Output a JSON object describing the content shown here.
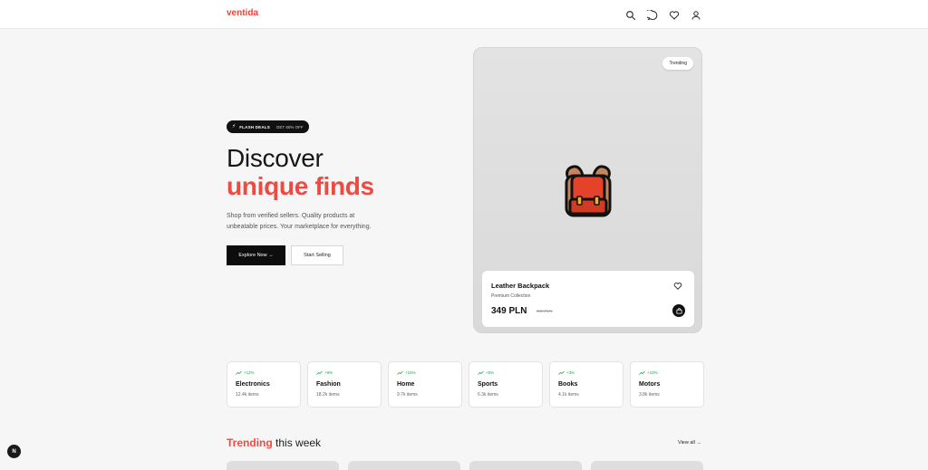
{
  "header": {
    "logo": "ventida",
    "icons": [
      "search-icon",
      "chat-icon",
      "heart-icon",
      "user-icon"
    ]
  },
  "hero": {
    "badge_label": "FLASH DEALS",
    "badge_offer": "GET 60% OFF",
    "headline_line1": "Discover",
    "headline_line2": "unique finds",
    "subtext": "Shop from verified sellers. Quality products at unbeatable prices. Your marketplace for everything.",
    "primary_cta": "Explore Now →",
    "secondary_cta": "Start Selling"
  },
  "featured": {
    "pill": "Trending",
    "product_name": "Leather Backpack",
    "collection": "Premium Collection",
    "price": "349 PLN",
    "old_price": "699 PLN",
    "image_icon": "backpack-icon"
  },
  "categories": [
    {
      "trend": "+12%",
      "name": "Electronics",
      "count": "12.4k items"
    },
    {
      "trend": "+8%",
      "name": "Fashion",
      "count": "18.2k items"
    },
    {
      "trend": "+15%",
      "name": "Home",
      "count": "9.7k items"
    },
    {
      "trend": "+5%",
      "name": "Sports",
      "count": "6.3k items"
    },
    {
      "trend": "+3%",
      "name": "Books",
      "count": "4.1k items"
    },
    {
      "trend": "+10%",
      "name": "Motors",
      "count": "3.8k items"
    }
  ],
  "trending_section": {
    "title_accent": "Trending",
    "title_rest": "this week",
    "view_all": "View all →"
  },
  "fab": {
    "letter": "N"
  },
  "colors": {
    "accent": "#ec4a42",
    "positive": "#25a244",
    "dark": "#111111"
  }
}
